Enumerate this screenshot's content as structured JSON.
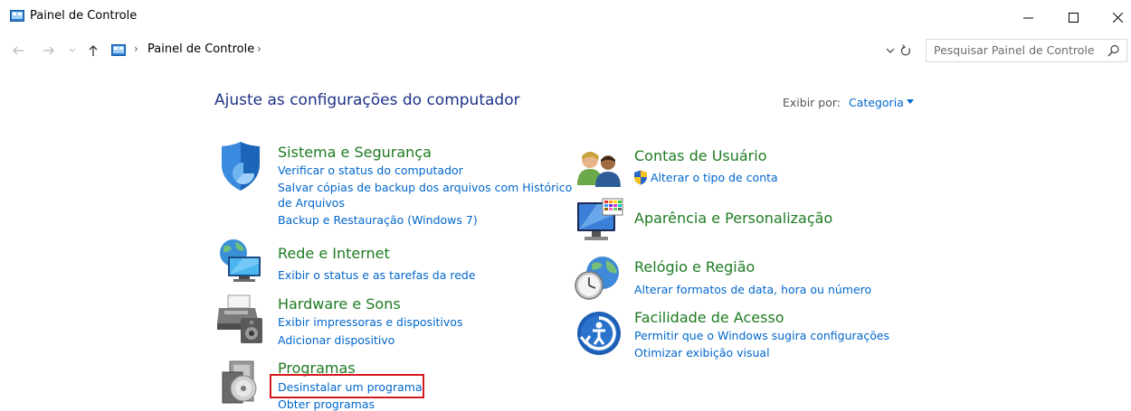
{
  "window": {
    "title": "Painel de Controle",
    "controls": {
      "minimize": "–",
      "maximize": "☐",
      "close": "✕"
    }
  },
  "address_bar": {
    "breadcrumb": "Painel de Controle",
    "separator": "›"
  },
  "search": {
    "placeholder": "Pesquisar Painel de Controle"
  },
  "header": {
    "title": "Ajuste as configurações do computador",
    "view_by_label": "Exibir por:",
    "view_by_value": "Categoria"
  },
  "categories": [
    {
      "title": "Sistema e Segurança",
      "icon": "shield-icon",
      "tasks": [
        "Verificar o status do computador",
        "Salvar cópias de backup dos arquivos com Histórico",
        "de Arquivos",
        "Backup e Restauração (Windows 7)"
      ]
    },
    {
      "title": "Rede e Internet",
      "icon": "network-globe-icon",
      "tasks": [
        "Exibir o status e as tarefas da rede"
      ]
    },
    {
      "title": "Hardware e Sons",
      "icon": "printer-speaker-icon",
      "tasks": [
        "Exibir impressoras e dispositivos",
        "Adicionar dispositivo"
      ]
    },
    {
      "title": "Programas",
      "icon": "programs-disc-icon",
      "tasks": [
        "Desinstalar um programa",
        "Obter programas"
      ]
    },
    {
      "title": "Contas de Usuário",
      "icon": "users-icon",
      "tasks": [
        "Alterar o tipo de conta"
      ]
    },
    {
      "title": "Aparência e Personalização",
      "icon": "monitor-palette-icon",
      "tasks": []
    },
    {
      "title": "Relógio e Região",
      "icon": "clock-globe-icon",
      "tasks": [
        "Alterar formatos de data, hora ou número"
      ]
    },
    {
      "title": "Facilidade de Acesso",
      "icon": "ease-of-access-icon",
      "tasks": [
        "Permitir que o Windows sugira configurações",
        "Otimizar exibição visual"
      ]
    }
  ],
  "colors": {
    "category_title": "#1e7b22",
    "task_link": "#0066cc",
    "page_title": "#1e3287",
    "highlight": "#d41920"
  }
}
